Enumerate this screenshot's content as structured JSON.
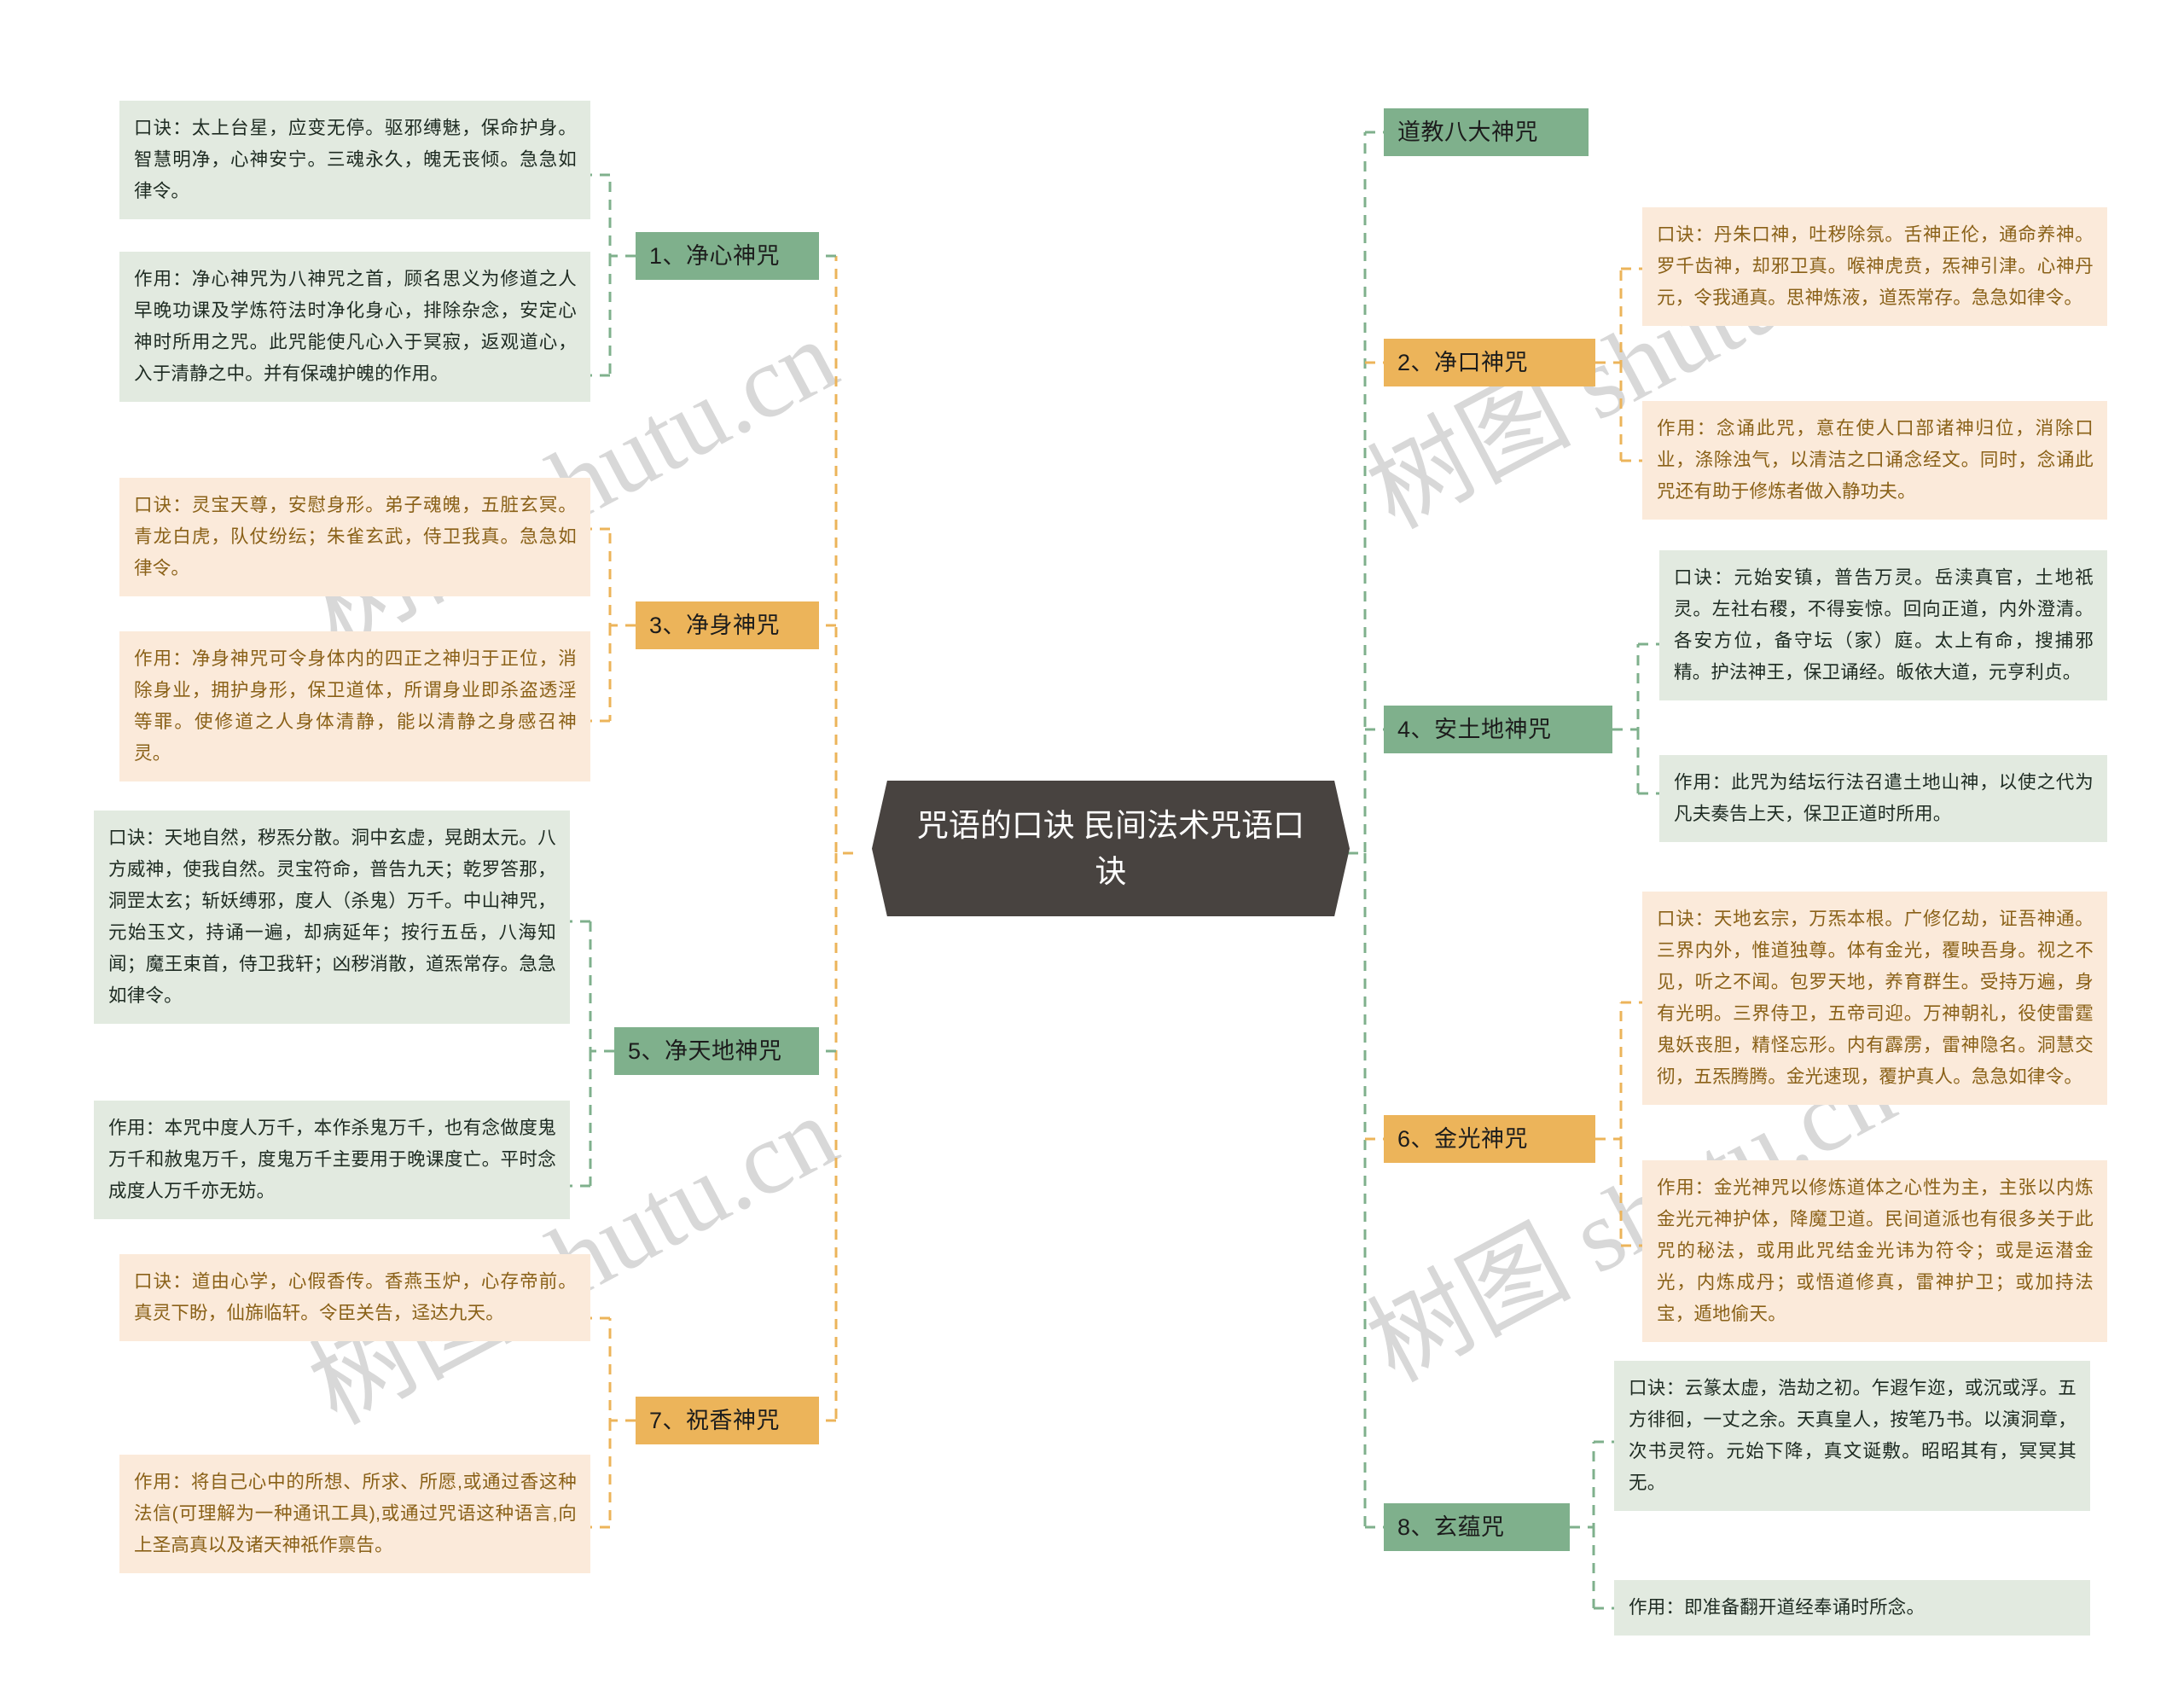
{
  "root": {
    "title": "咒语的口诀  民间法术咒语口诀"
  },
  "colors": {
    "green_branch": "#7fb08c",
    "orange_branch": "#ecb45a",
    "green_leaf_bg": "#e2eae0",
    "orange_leaf_bg": "#fbeada",
    "root_bg": "#484340",
    "green_link": "#7fb08c",
    "orange_link": "#ecb45a"
  },
  "watermark": {
    "text": "树图 shutu.cn"
  },
  "branches": [
    {
      "id": "b1",
      "label": "1、净心神咒",
      "color": "green",
      "side": "left",
      "leaves": [
        {
          "id": "b1l1",
          "tone": "lgreen",
          "text": "口诀：太上台星，应变无停。驱邪缚魅，保命护身。智慧明净，心神安宁。三魂永久，魄无丧倾。急急如律令。"
        },
        {
          "id": "b1l2",
          "tone": "lgreen",
          "text": "作用：净心神咒为八神咒之首，顾名思义为修道之人早晚功课及学炼符法时净化身心，排除杂念，安定心神时所用之咒。此咒能使凡心入于冥寂，返观道心，入于清静之中。并有保魂护魄的作用。"
        }
      ]
    },
    {
      "id": "b3",
      "label": "3、净身神咒",
      "color": "orange",
      "side": "left",
      "leaves": [
        {
          "id": "b3l1",
          "tone": "lorange",
          "text": "口诀：灵宝天尊，安慰身形。弟子魂魄，五脏玄冥。青龙白虎，队仗纷纭；朱雀玄武，侍卫我真。急急如律令。"
        },
        {
          "id": "b3l2",
          "tone": "lorange",
          "text": "作用：净身神咒可令身体内的四正之神归于正位，消除身业，拥护身形，保卫道体，所谓身业即杀盗透淫等罪。使修道之人身体清静，能以清静之身感召神灵。"
        }
      ]
    },
    {
      "id": "b5",
      "label": "5、净天地神咒",
      "color": "green",
      "side": "left",
      "leaves": [
        {
          "id": "b5l1",
          "tone": "lgreen",
          "text": "口诀：天地自然，秽炁分散。洞中玄虚，晃朗太元。八方威神，使我自然。灵宝符命，普告九天；乾罗答那，洞罡太玄；斩妖缚邪，度人（杀鬼）万千。中山神咒，元始玉文，持诵一遍，却病延年；按行五岳，八海知闻；魔王束首，侍卫我轩；凶秽消散，道炁常存。急急如律令。"
        },
        {
          "id": "b5l2",
          "tone": "lgreen",
          "text": "作用：本咒中度人万千，本作杀鬼万千，也有念做度鬼万千和赦鬼万千，度鬼万千主要用于晚课度亡。平时念成度人万千亦无妨。"
        }
      ]
    },
    {
      "id": "b7",
      "label": "7、祝香神咒",
      "color": "orange",
      "side": "left",
      "leaves": [
        {
          "id": "b7l1",
          "tone": "lorange",
          "text": "口诀：道由心学，心假香传。香燕玉炉，心存帝前。真灵下盼，仙旆临轩。令臣关告，迳达九天。"
        },
        {
          "id": "b7l2",
          "tone": "lorange",
          "text": "作用：将自己心中的所想、所求、所愿,或通过香这种法信(可理解为一种通讯工具),或通过咒语这种语言,向上圣高真以及诸天神祇作禀告。"
        }
      ]
    },
    {
      "id": "b0",
      "label": "道教八大神咒",
      "color": "green",
      "side": "right",
      "leaves": []
    },
    {
      "id": "b2",
      "label": "2、净口神咒",
      "color": "orange",
      "side": "right",
      "leaves": [
        {
          "id": "b2l1",
          "tone": "lorange",
          "text": "口诀：丹朱口神，吐秽除氛。舌神正伦，通命养神。罗千齿神，却邪卫真。喉神虎贲，炁神引津。心神丹元，令我通真。思神炼液，道炁常存。急急如律令。"
        },
        {
          "id": "b2l2",
          "tone": "lorange",
          "text": "作用：念诵此咒，意在使人口部诸神归位，消除口业，涤除浊气，以清洁之口诵念经文。同时，念诵此咒还有助于修炼者做入静功夫。"
        }
      ]
    },
    {
      "id": "b4",
      "label": "4、安土地神咒",
      "color": "green",
      "side": "right",
      "leaves": [
        {
          "id": "b4l1",
          "tone": "lgreen",
          "text": "口诀：元始安镇，普告万灵。岳渎真官，土地祇灵。左社右稷，不得妄惊。回向正道，内外澄清。各安方位，备守坛（家）庭。太上有命，搜捕邪精。护法神王，保卫诵经。皈依大道，元亨利贞。"
        },
        {
          "id": "b4l2",
          "tone": "lgreen",
          "text": "作用：此咒为结坛行法召遣土地山神，以使之代为凡夫奏告上天，保卫正道时所用。"
        }
      ]
    },
    {
      "id": "b6",
      "label": "6、金光神咒",
      "color": "orange",
      "side": "right",
      "leaves": [
        {
          "id": "b6l1",
          "tone": "lorange",
          "text": "口诀：天地玄宗，万炁本根。广修亿劫，证吾神通。三界内外，惟道独尊。体有金光，覆映吾身。视之不见，听之不闻。包罗天地，养育群生。受持万遍，身有光明。三界侍卫，五帝司迎。万神朝礼，役使雷霆鬼妖丧胆，精怪忘形。内有霹雳，雷神隐名。洞慧交彻，五炁腾腾。金光速现，覆护真人。急急如律令。"
        },
        {
          "id": "b6l2",
          "tone": "lorange",
          "text": "作用：金光神咒以修炼道体之心性为主，主张以内炼金光元神护体，降魔卫道。民间道派也有很多关于此咒的秘法，或用此咒结金光讳为符令；或是运潜金光，内炼成丹；或悟道修真，雷神护卫；或加持法宝，遁地偷天。"
        }
      ]
    },
    {
      "id": "b8",
      "label": "8、玄蕴咒",
      "color": "green",
      "side": "right",
      "leaves": [
        {
          "id": "b8l1",
          "tone": "lgreen",
          "text": "口诀：云篆太虚，浩劫之初。乍遐乍迩，或沉或浮。五方徘徊，一丈之余。天真皇人，按笔乃书。以演洞章，次书灵符。元始下降，真文诞敷。昭昭其有，冥冥其无。"
        },
        {
          "id": "b8l2",
          "tone": "lgreen",
          "text": "作用：即准备翻开道经奉诵时所念。"
        }
      ]
    }
  ]
}
